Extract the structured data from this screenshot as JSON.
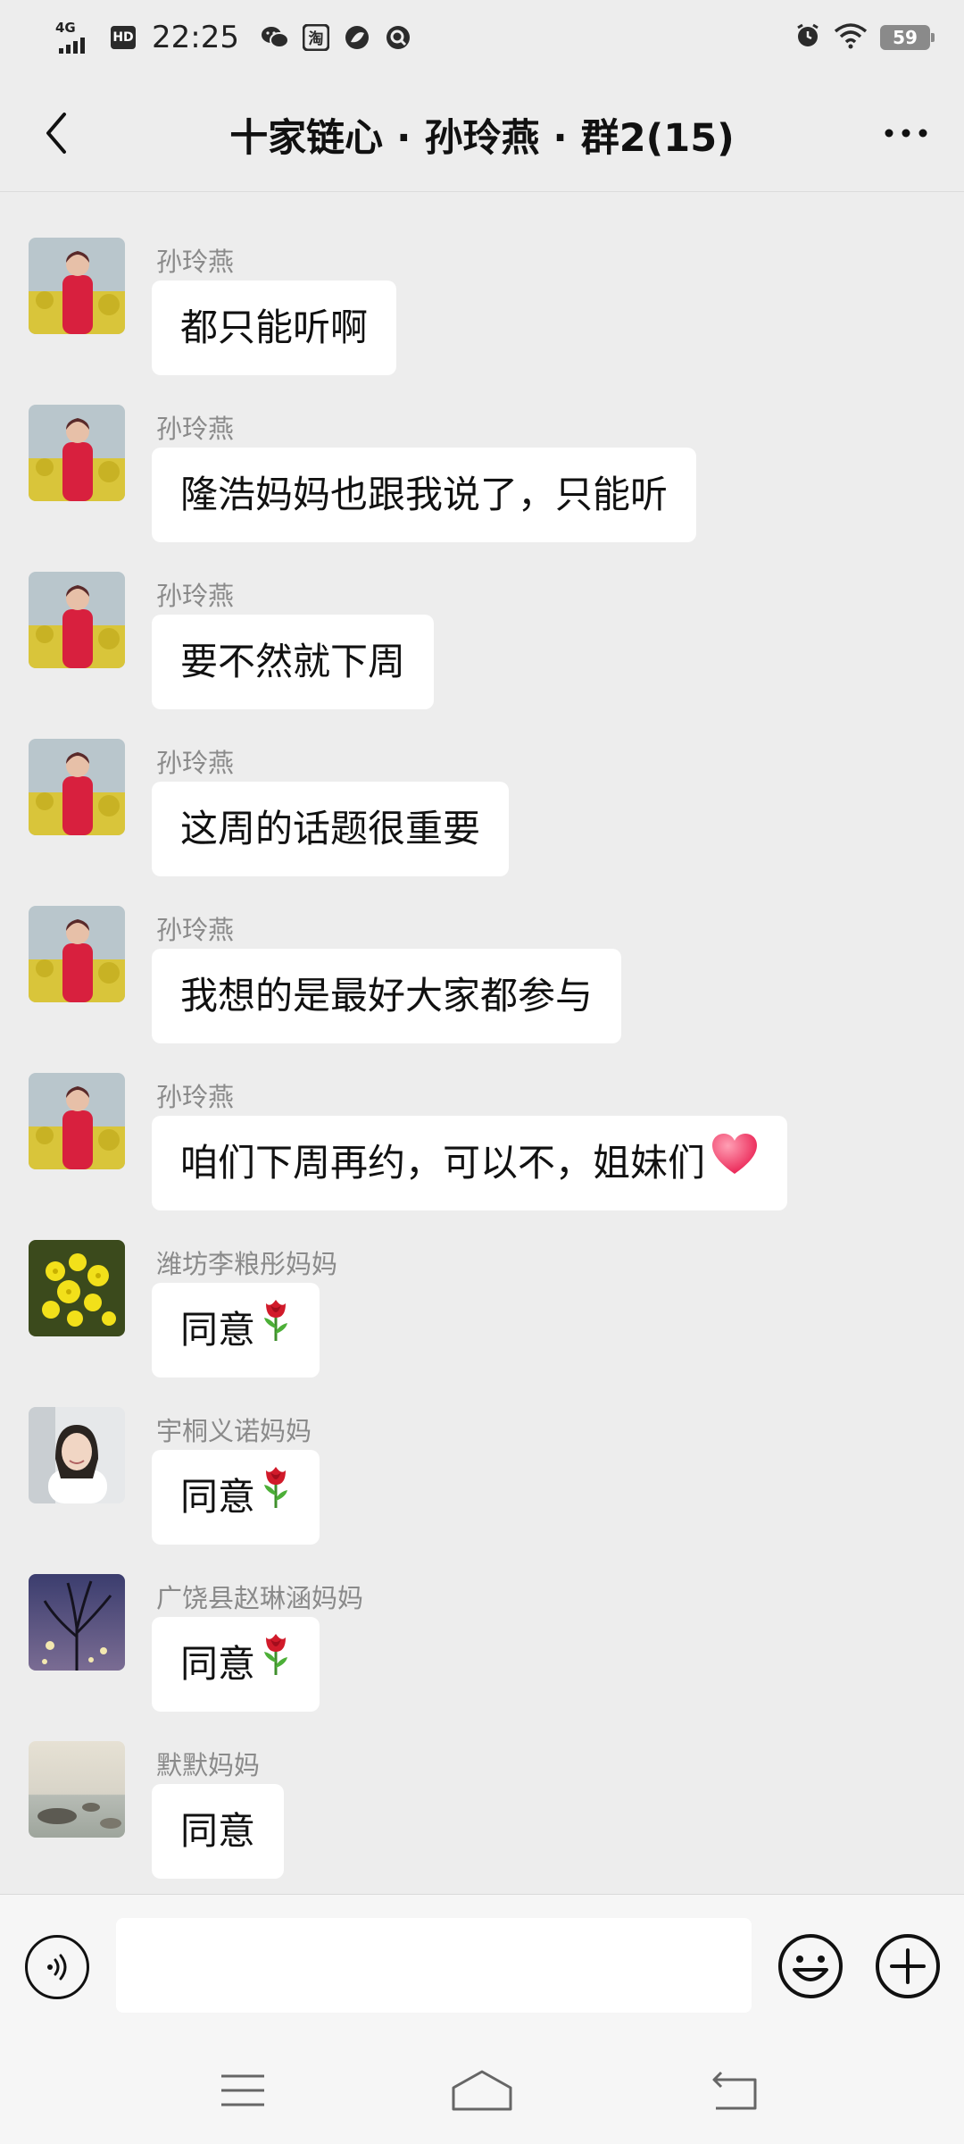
{
  "status_bar": {
    "network": "4G",
    "hd": "HD",
    "time": "22:25",
    "battery": "59",
    "icons": [
      "wechat-icon",
      "taobao-icon",
      "leaf-app-icon",
      "search-app-icon",
      "alarm-icon",
      "wifi-icon"
    ]
  },
  "header": {
    "title": "十家链心 · 孙玲燕 · 群2(15)",
    "back_icon": "chevron-left-icon",
    "more_icon": "more-dots-icon"
  },
  "messages": [
    {
      "sender": "孙玲燕",
      "text": "都只能听啊",
      "emoji": ""
    },
    {
      "sender": "孙玲燕",
      "text": "隆浩妈妈也跟我说了，只能听",
      "emoji": ""
    },
    {
      "sender": "孙玲燕",
      "text": "要不然就下周",
      "emoji": ""
    },
    {
      "sender": "孙玲燕",
      "text": "这周的话题很重要",
      "emoji": ""
    },
    {
      "sender": "孙玲燕",
      "text": "我想的是最好大家都参与",
      "emoji": ""
    },
    {
      "sender": "孙玲燕",
      "text": "咱们下周再约，可以不，姐妹们",
      "emoji": "heart"
    },
    {
      "sender": "潍坊李粮彤妈妈",
      "text": "同意",
      "emoji": "rose"
    },
    {
      "sender": "宇桐义诺妈妈",
      "text": "同意",
      "emoji": "rose"
    },
    {
      "sender": "广饶县赵琳涵妈妈",
      "text": "同意",
      "emoji": "rose"
    },
    {
      "sender": "默默妈妈",
      "text": "同意",
      "emoji": ""
    }
  ],
  "input_bar": {
    "value": "",
    "icons": [
      "voice-icon",
      "emoji-icon",
      "plus-icon"
    ]
  },
  "nav_bar": {
    "icons": [
      "menu-icon",
      "home-icon",
      "back-nav-icon"
    ]
  },
  "colors": {
    "background": "#ededed",
    "bubble": "#ffffff",
    "sender": "#8a8a8a",
    "accent_red": "#e8174b"
  }
}
